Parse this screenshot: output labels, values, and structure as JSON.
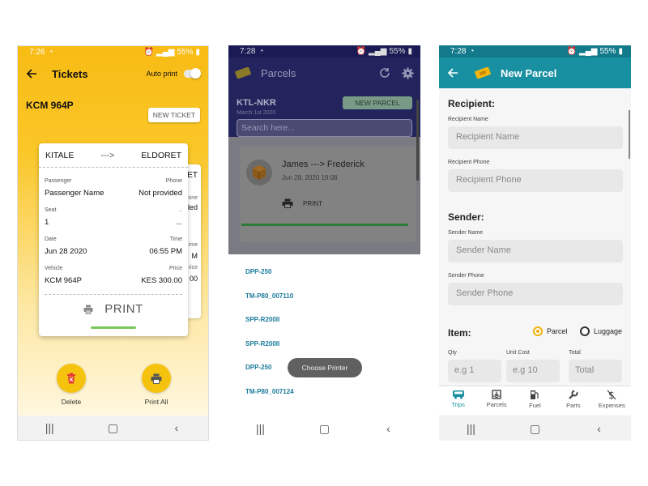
{
  "phone1": {
    "status_time": "7:26",
    "status_battery": "55%",
    "title": "Tickets",
    "auto_print_label": "Auto print",
    "plate": "KCM 964P",
    "new_ticket_label": "NEW TICKET",
    "ticket": {
      "from": "KITALE",
      "arrow": "--->",
      "to": "ELDORET",
      "passenger_label": "Passenger",
      "passenger_value": "Passenger Name",
      "phone_label": "Phone",
      "phone_value": "Not provided",
      "seat_label": "Seat",
      "seat_value": "1",
      "seat_right_label": "..",
      "seat_right_value": "...",
      "date_label": "Date",
      "date_value": "Jun 28 2020",
      "time_label": "Time",
      "time_value": "06:55 PM",
      "vehicle_label": "Vehicle",
      "vehicle_value": "KCM 964P",
      "price_label": "Price",
      "price_value": "KES 300.00",
      "print_label": "PRINT"
    },
    "back_ticket": {
      "to": "ELDORET",
      "phone_label": "one",
      "phone_value": "ided",
      "time_label": "ime",
      "time_value": "M",
      "price_label": "rice",
      "price_value": "00"
    },
    "delete_label": "Delete",
    "print_all_label": "Print All"
  },
  "phone2": {
    "status_time": "7:28",
    "status_battery": "55%",
    "title": "Parcels",
    "route": "KTL-NKR",
    "date": "March 1st 2020",
    "new_parcel_label": "NEW PARCEL",
    "search_placeholder": "Search here...",
    "card": {
      "names": "James  --->  Frederick",
      "date": "Jun 28, 2020 19:08",
      "print_label": "PRINT"
    },
    "printers": [
      "DPP-250",
      "TM-P80_007110",
      "SPP-R200II",
      "SPP-R200II",
      "DPP-250",
      "TM-P80_007124"
    ],
    "toast": "Choose Printer"
  },
  "phone3": {
    "status_time": "7:28",
    "status_battery": "55%",
    "title": "New Parcel",
    "recipient_heading": "Recipient:",
    "recipient_name_label": "Recipient Name",
    "recipient_name_placeholder": "Recipient Name",
    "recipient_phone_label": "Recipient Phone",
    "recipient_phone_placeholder": "Recipient Phone",
    "sender_heading": "Sender:",
    "sender_name_label": "Sender Name",
    "sender_name_placeholder": "Sender Name",
    "sender_phone_label": "Sender Phone",
    "sender_phone_placeholder": "Sender Phone",
    "item_heading": "Item:",
    "radio_parcel": "Parcel",
    "radio_luggage": "Luggage",
    "selected_item_type": "Parcel",
    "qty_label": "Qty",
    "qty_placeholder": "e.g 1",
    "unit_cost_label": "Unit Cost",
    "unit_cost_placeholder": "e.g 10",
    "total_label": "Total",
    "total_placeholder": "Total",
    "bottom_nav": [
      "Trips",
      "Parcels",
      "Fuel",
      "Parts",
      "Expenses"
    ],
    "active_tab": "Trips"
  },
  "colors": {
    "tickets_yellow": "#f8bb14",
    "parcels_navy": "#23235e",
    "new_parcel_teal": "#1890a2",
    "printer_text": "#1a7a9a",
    "print_green": "#7ac65a"
  }
}
